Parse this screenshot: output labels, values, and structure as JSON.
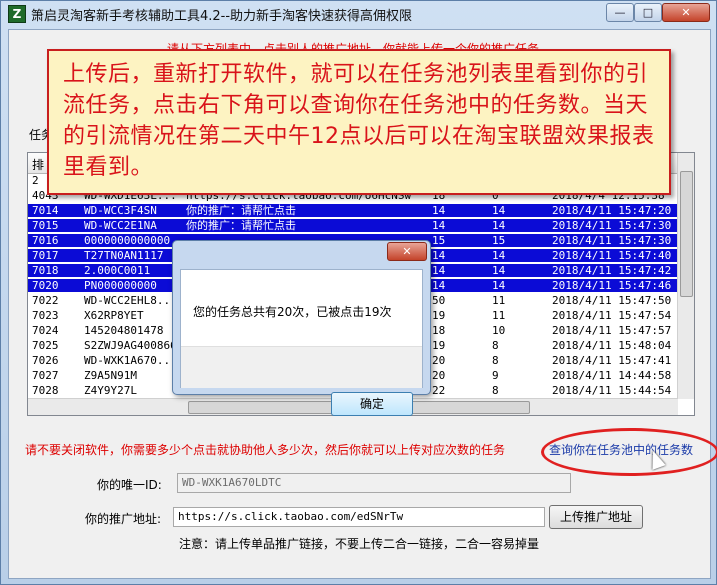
{
  "window": {
    "title": "箫启灵淘客新手考核辅助工具4.2--助力新手淘客快速获得高佣权限",
    "icon_letter": "Z",
    "min_glyph": "—",
    "max_glyph": "□",
    "close_glyph": "✕"
  },
  "top_hint": "请从下方列表中，点击别人的推广地址，你就能上传一个你的推广任务",
  "left_label": "任务",
  "table": {
    "headers": [
      "排",
      "",
      "",
      "",
      "",
      ""
    ],
    "rows": [
      {
        "c": [
          "2",
          "",
          "",
          "",
          "",
          ""
        ],
        "sel": false
      },
      {
        "c": [
          "4043",
          "WD-WXD1E63L...",
          "https://s.click.taobao.com/o6HcNSw",
          "18",
          "0",
          "2018/4/4 12:15:38"
        ],
        "sel": false
      },
      {
        "c": [
          "7014",
          "WD-WCC3F4SN",
          "你的推广：请帮忙点击",
          "14",
          "14",
          "2018/4/11 15:47:20"
        ],
        "sel": true
      },
      {
        "c": [
          "7015",
          "WD-WCC2E1NA",
          "你的推广：请帮忙点击",
          "14",
          "14",
          "2018/4/11 15:47:30"
        ],
        "sel": true
      },
      {
        "c": [
          "7016",
          "0000000000000",
          "",
          "15",
          "15",
          "2018/4/11 15:47:30"
        ],
        "sel": true
      },
      {
        "c": [
          "7017",
          "T27TN0AN1117",
          "",
          "14",
          "14",
          "2018/4/11 15:47:40"
        ],
        "sel": true
      },
      {
        "c": [
          "7018",
          "2.000C0011",
          "",
          "14",
          "14",
          "2018/4/11 15:47:42"
        ],
        "sel": true
      },
      {
        "c": [
          "7020",
          "PN000000000",
          "",
          "14",
          "14",
          "2018/4/11 15:47:46"
        ],
        "sel": true
      },
      {
        "c": [
          "7022",
          "WD-WCC2EHL8...",
          "",
          "50",
          "11",
          "2018/4/11  15:47:50"
        ],
        "sel": false
      },
      {
        "c": [
          "7023",
          "X62RP8YET",
          "",
          "19",
          "11",
          "2018/4/11  15:47:54"
        ],
        "sel": false
      },
      {
        "c": [
          "7024",
          "145204801478",
          "",
          "18",
          "10",
          "2018/4/11  15:47:57"
        ],
        "sel": false
      },
      {
        "c": [
          "7025",
          "S2ZWJ9AG400866",
          "",
          "19",
          "8",
          "2018/4/11  15:48:04"
        ],
        "sel": false
      },
      {
        "c": [
          "7026",
          "WD-WXK1A670...",
          "",
          "20",
          "8",
          "2018/4/11  15:47:41"
        ],
        "sel": false
      },
      {
        "c": [
          "7027",
          "Z9A5N91M",
          "",
          "20",
          "9",
          "2018/4/11  14:44:58"
        ],
        "sel": false
      },
      {
        "c": [
          "7028",
          "Z4Y9Y27L",
          "",
          "22",
          "8",
          "2018/4/11  15:44:54"
        ],
        "sel": false
      }
    ]
  },
  "warning": "请不要关闭软件，你需要多少个点击就协助他人多少次，然后你就可以上传对应次数的任务",
  "query_link": "查询你在任务池中的任务数",
  "id_label": "你的唯一ID:",
  "id_value": "WD-WXK1A670LDTC",
  "url_label": "你的推广地址:",
  "url_value": "https://s.click.taobao.com/edSNrTw",
  "upload_button": "上传推广地址",
  "note": "注意：请上传单品推广链接，不要上传二合一链接，二合一容易掉量",
  "overlay_text": "上传后，重新打开软件，就可以在任务池列表里看到你的引流任务，点击右下角可以查询你在任务池中的任务数。当天的引流情况在第二天中午12点以后可以在淘宝联盟效果报表里看到。",
  "dialog": {
    "message": "您的任务总共有20次，已被点击19次",
    "ok_label": "确定",
    "close_glyph": "✕"
  }
}
